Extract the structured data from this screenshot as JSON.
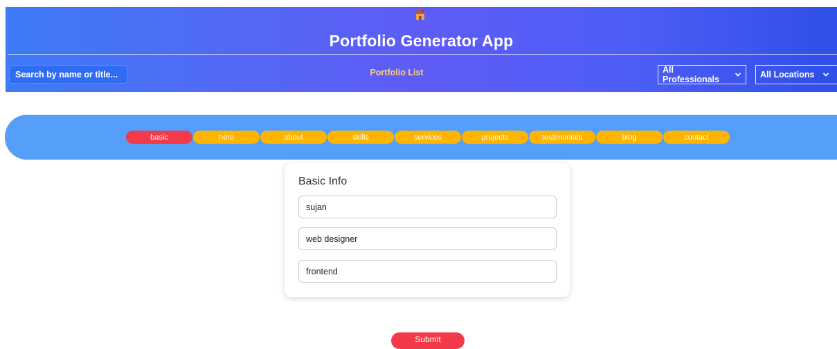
{
  "header": {
    "home_icon": "house-icon",
    "title": "Portfolio Generator App",
    "search": {
      "placeholder": "Search by name or title..."
    },
    "nav_link": "Portfolio List",
    "filters": {
      "professionals": "All Professionals",
      "locations": "All Locations"
    },
    "colors": {
      "gradient_start": "#3d7bf7",
      "gradient_mid": "#5f5cf6",
      "gradient_end": "#2f4fe8",
      "nav_link": "#ffd27a"
    }
  },
  "tabs": {
    "items": [
      {
        "label": "basic",
        "active": true
      },
      {
        "label": "hero",
        "active": false
      },
      {
        "label": "about",
        "active": false
      },
      {
        "label": "skills",
        "active": false
      },
      {
        "label": "services",
        "active": false
      },
      {
        "label": "projects",
        "active": false
      },
      {
        "label": "testimonials",
        "active": false
      },
      {
        "label": "blog",
        "active": false
      },
      {
        "label": "contact",
        "active": false
      }
    ],
    "colors": {
      "bar": "#559ef9",
      "tab": "#ffb400",
      "active": "#f23a4a"
    }
  },
  "form": {
    "title": "Basic Info",
    "fields": [
      {
        "value": "sujan"
      },
      {
        "value": "web designer"
      },
      {
        "value": "frontend"
      }
    ],
    "submit_label": "Submit"
  }
}
